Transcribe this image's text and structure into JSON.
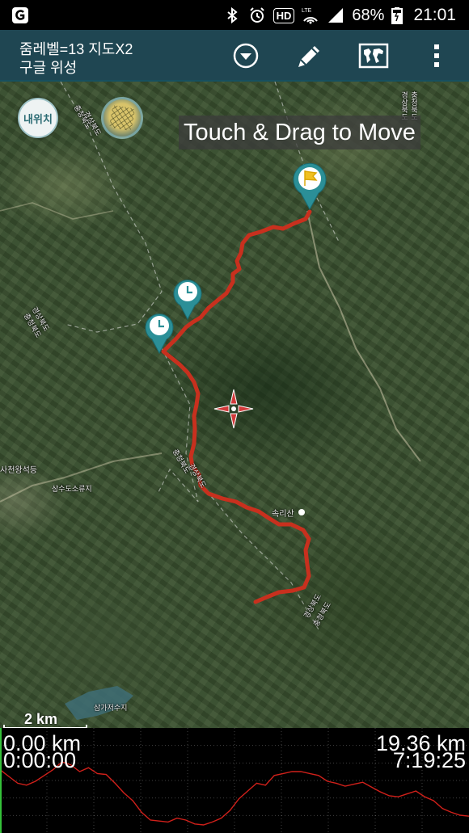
{
  "status_bar": {
    "battery_percent": "68%",
    "time": "21:01",
    "hd_badge": "HD",
    "lte_label": "LTE",
    "icons": [
      "app-logo-icon",
      "bluetooth-icon",
      "alarm-icon",
      "hd-icon",
      "lte-signal-icon",
      "cell-signal-icon",
      "battery-icon"
    ]
  },
  "action_bar": {
    "title_line1": "줌레벨=13 지도X2",
    "title_line2": "구글 위성",
    "buttons": [
      "dropdown-icon",
      "pencil-icon",
      "world-map-icon",
      "overflow-menu-icon"
    ]
  },
  "map": {
    "my_location_button": "내위치",
    "toast": "Touch & Drag to Move",
    "scale_label": "2 km",
    "labels": {
      "border_top_1": "충청북도",
      "border_top_2": "경상북도",
      "border_topright_1": "경상북도",
      "border_topright_2": "충청북도",
      "border_left_1": "경상북도",
      "border_left_2": "충청북도",
      "temple": "사천왕석등",
      "sangsu": "상수도소류지",
      "border_mid_1": "충청북도",
      "border_mid_2": "경상북도",
      "peak": "속리산",
      "border_low_1": "경상북도",
      "border_low_2": "충청북도",
      "reservoir": "삼가저수지"
    },
    "markers": [
      "flag-marker",
      "clock-marker",
      "clock-marker"
    ],
    "colors": {
      "track": "#c8301e",
      "marker": "#2b8f97"
    }
  },
  "profile": {
    "distance_start": "0.00 km",
    "time_start": "0:00:00",
    "distance_total": "19.36 km",
    "time_total": "7:19:25",
    "elevation_line": [
      62,
      55,
      48,
      46,
      50,
      56,
      62,
      70,
      67,
      60,
      64,
      58,
      57,
      48,
      38,
      30,
      18,
      10,
      9,
      8,
      12,
      10,
      6,
      5,
      8,
      12,
      20,
      32,
      40,
      48,
      46,
      56,
      58,
      60,
      60,
      58,
      56,
      50,
      48,
      45,
      47,
      49,
      44,
      39,
      35,
      34,
      37,
      40,
      34,
      30,
      22,
      18,
      15,
      14
    ]
  }
}
